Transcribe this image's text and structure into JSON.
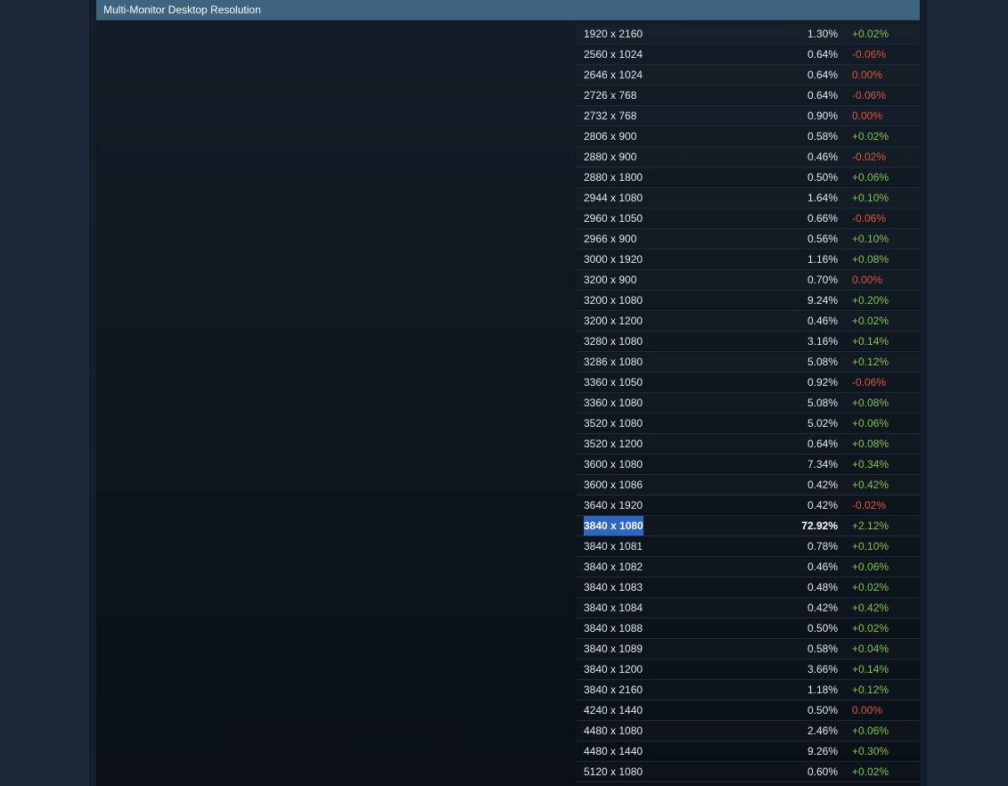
{
  "panel": {
    "title": "Multi-Monitor Desktop Resolution"
  },
  "rows": [
    {
      "res": "1920 x 2160",
      "pct": "1.30%",
      "chg": "+0.02%",
      "dir": "up"
    },
    {
      "res": "2560 x 1024",
      "pct": "0.64%",
      "chg": "-0.06%",
      "dir": "down"
    },
    {
      "res": "2646 x 1024",
      "pct": "0.64%",
      "chg": "0.00%",
      "dir": "down"
    },
    {
      "res": "2726 x 768",
      "pct": "0.64%",
      "chg": "-0.06%",
      "dir": "down"
    },
    {
      "res": "2732 x 768",
      "pct": "0.90%",
      "chg": "0.00%",
      "dir": "down"
    },
    {
      "res": "2806 x 900",
      "pct": "0.58%",
      "chg": "+0.02%",
      "dir": "up"
    },
    {
      "res": "2880 x 900",
      "pct": "0.46%",
      "chg": "-0.02%",
      "dir": "down"
    },
    {
      "res": "2880 x 1800",
      "pct": "0.50%",
      "chg": "+0.06%",
      "dir": "up"
    },
    {
      "res": "2944 x 1080",
      "pct": "1.64%",
      "chg": "+0.10%",
      "dir": "up"
    },
    {
      "res": "2960 x 1050",
      "pct": "0.66%",
      "chg": "-0.06%",
      "dir": "down"
    },
    {
      "res": "2966 x 900",
      "pct": "0.56%",
      "chg": "+0.10%",
      "dir": "up"
    },
    {
      "res": "3000 x 1920",
      "pct": "1.16%",
      "chg": "+0.08%",
      "dir": "up"
    },
    {
      "res": "3200 x 900",
      "pct": "0.70%",
      "chg": "0.00%",
      "dir": "down"
    },
    {
      "res": "3200 x 1080",
      "pct": "9.24%",
      "chg": "+0.20%",
      "dir": "up"
    },
    {
      "res": "3200 x 1200",
      "pct": "0.46%",
      "chg": "+0.02%",
      "dir": "up"
    },
    {
      "res": "3280 x 1080",
      "pct": "3.16%",
      "chg": "+0.14%",
      "dir": "up"
    },
    {
      "res": "3286 x 1080",
      "pct": "5.08%",
      "chg": "+0.12%",
      "dir": "up"
    },
    {
      "res": "3360 x 1050",
      "pct": "0.92%",
      "chg": "-0.06%",
      "dir": "down"
    },
    {
      "res": "3360 x 1080",
      "pct": "5.08%",
      "chg": "+0.08%",
      "dir": "up"
    },
    {
      "res": "3520 x 1080",
      "pct": "5.02%",
      "chg": "+0.06%",
      "dir": "up"
    },
    {
      "res": "3520 x 1200",
      "pct": "0.64%",
      "chg": "+0.08%",
      "dir": "up"
    },
    {
      "res": "3600 x 1080",
      "pct": "7.34%",
      "chg": "+0.34%",
      "dir": "up"
    },
    {
      "res": "3600 x 1086",
      "pct": "0.42%",
      "chg": "+0.42%",
      "dir": "up"
    },
    {
      "res": "3640 x 1920",
      "pct": "0.42%",
      "chg": "-0.02%",
      "dir": "down"
    },
    {
      "res": "3840 x 1080",
      "pct": "72.92%",
      "chg": "+2.12%",
      "dir": "up",
      "highlight": true
    },
    {
      "res": "3840 x 1081",
      "pct": "0.78%",
      "chg": "+0.10%",
      "dir": "up"
    },
    {
      "res": "3840 x 1082",
      "pct": "0.46%",
      "chg": "+0.06%",
      "dir": "up"
    },
    {
      "res": "3840 x 1083",
      "pct": "0.48%",
      "chg": "+0.02%",
      "dir": "up"
    },
    {
      "res": "3840 x 1084",
      "pct": "0.42%",
      "chg": "+0.42%",
      "dir": "up"
    },
    {
      "res": "3840 x 1088",
      "pct": "0.50%",
      "chg": "+0.02%",
      "dir": "up"
    },
    {
      "res": "3840 x 1089",
      "pct": "0.58%",
      "chg": "+0.04%",
      "dir": "up"
    },
    {
      "res": "3840 x 1200",
      "pct": "3.66%",
      "chg": "+0.14%",
      "dir": "up"
    },
    {
      "res": "3840 x 2160",
      "pct": "1.18%",
      "chg": "+0.12%",
      "dir": "up"
    },
    {
      "res": "4240 x 1440",
      "pct": "0.50%",
      "chg": "0.00%",
      "dir": "down"
    },
    {
      "res": "4480 x 1080",
      "pct": "2.46%",
      "chg": "+0.06%",
      "dir": "up"
    },
    {
      "res": "4480 x 1440",
      "pct": "9.26%",
      "chg": "+0.30%",
      "dir": "up"
    },
    {
      "res": "5120 x 1080",
      "pct": "0.60%",
      "chg": "+0.02%",
      "dir": "up"
    }
  ],
  "colors": {
    "up": "#7ac54b",
    "down": "#e0523b",
    "header": "#3e6480",
    "highlight": "#2b66c4"
  }
}
